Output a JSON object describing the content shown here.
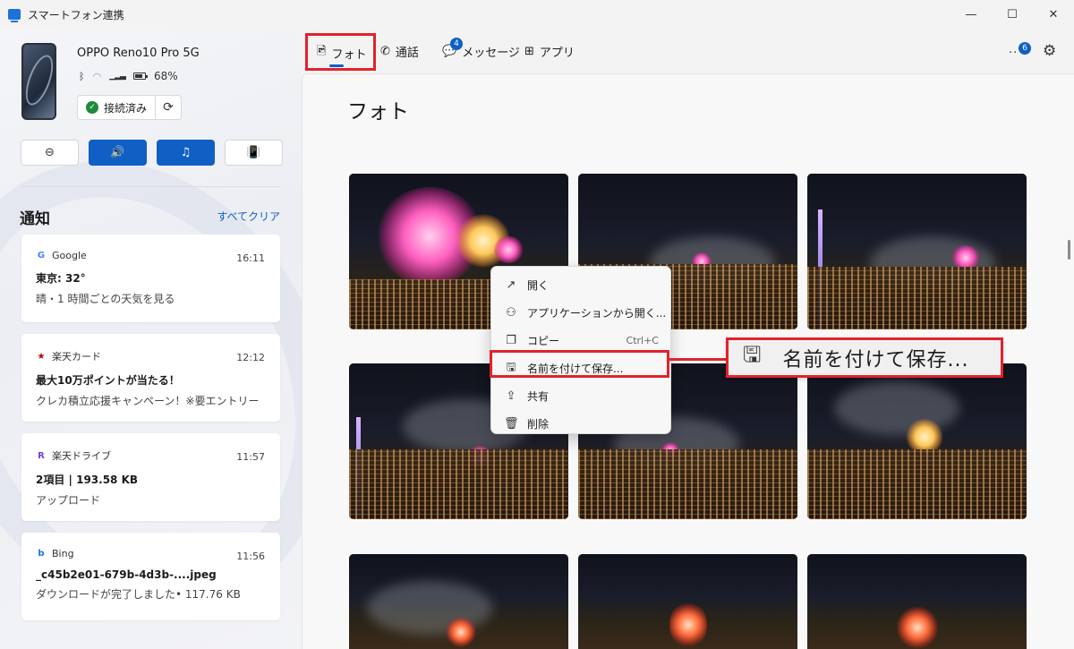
{
  "window": {
    "title": "スマートフォン連携",
    "minimize": "—",
    "maximize": "☐",
    "close": "✕"
  },
  "device": {
    "name": "OPPO Reno10 Pro 5G",
    "battery": "68%",
    "connection_label": "接続済み"
  },
  "quick_actions": [
    {
      "name": "dnd",
      "icon": "⊖"
    },
    {
      "name": "volume",
      "icon": "🔊"
    },
    {
      "name": "media",
      "icon": "♫"
    },
    {
      "name": "ring",
      "icon": "📳"
    }
  ],
  "notifications": {
    "title": "通知",
    "clear_all": "すべてクリア",
    "items": [
      {
        "app": "Google",
        "glyph": "G",
        "glyph_color": "#4285f4",
        "time": "16:11",
        "title": "東京: 32°",
        "body": "晴・1 時間ごとの天気を見る"
      },
      {
        "app": "楽天カード",
        "glyph": "★",
        "glyph_color": "#bf0000",
        "time": "12:12",
        "title": "最大10万ポイントが当たる！",
        "body": "クレカ積立応援キャンペーン！※要エントリー"
      },
      {
        "app": "楽天ドライブ",
        "glyph": "R",
        "glyph_color": "#7a3fd1",
        "time": "11:57",
        "title": "2項目 | 193.58 KB",
        "body": "アップロード"
      },
      {
        "app": "Bing",
        "glyph": "b",
        "glyph_color": "#1a73d9",
        "time": "11:56",
        "title": "_c45b2e01-679b-4d3b-....jpeg",
        "body": "ダウンロードが完了しました• 117.76 KB"
      }
    ]
  },
  "tabs": {
    "photos": "フォト",
    "calls": "通話",
    "messages": "メッセージ",
    "messages_badge": "4",
    "apps": "アプリ",
    "more_badge": "6"
  },
  "main": {
    "title": "フォト"
  },
  "context_menu": {
    "items": [
      {
        "label": "開く",
        "icon": "open-icon",
        "glyph": "↗",
        "shortcut": ""
      },
      {
        "label": "アプリケーションから開く...",
        "icon": "open-with-icon",
        "glyph": "⚇",
        "shortcut": ""
      },
      {
        "label": "コピー",
        "icon": "copy-icon",
        "glyph": "❐",
        "shortcut": "Ctrl+C"
      },
      {
        "label": "名前を付けて保存...",
        "icon": "save-icon",
        "glyph": "🖫",
        "shortcut": ""
      },
      {
        "label": "共有",
        "icon": "share-icon",
        "glyph": "⇪",
        "shortcut": ""
      },
      {
        "label": "削除",
        "icon": "delete-icon",
        "glyph": "🗑",
        "shortcut": ""
      }
    ]
  },
  "callout": {
    "label": "名前を付けて保存..."
  },
  "colors": {
    "accent": "#0f5fc5",
    "highlight": "#e2222b"
  }
}
